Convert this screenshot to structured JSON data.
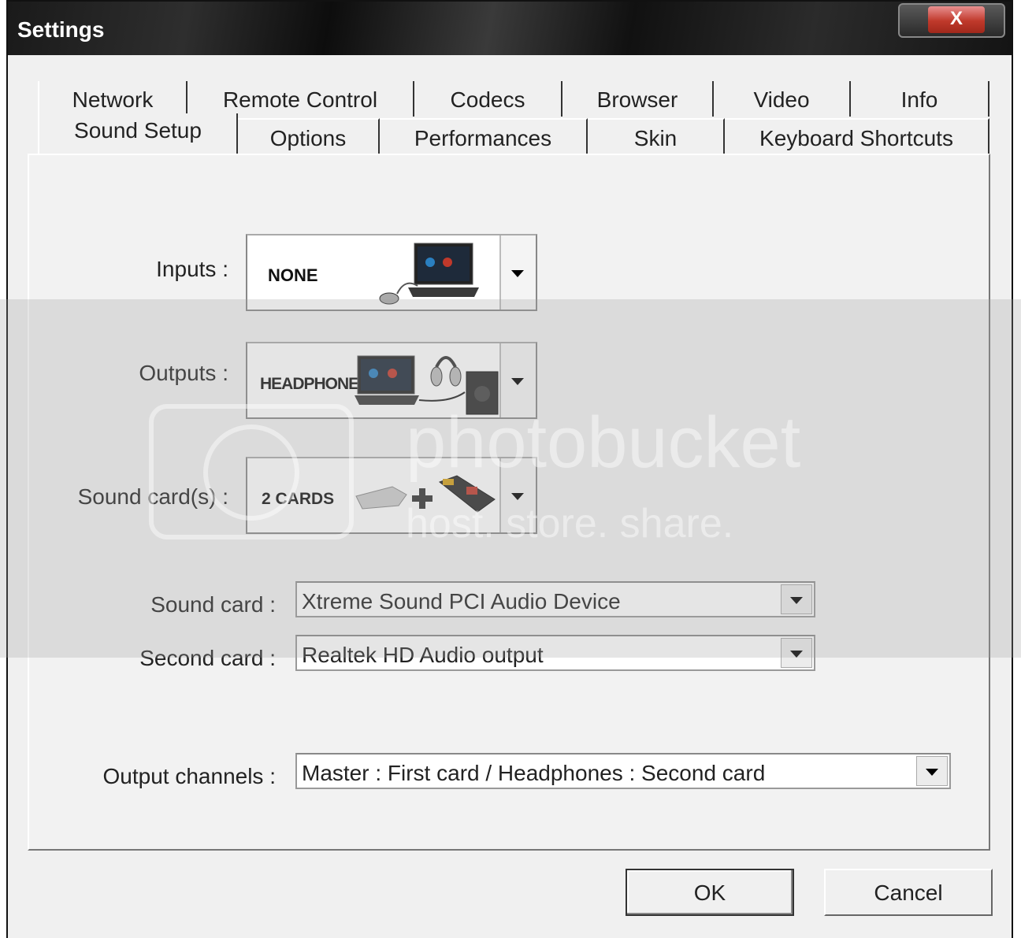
{
  "window": {
    "title": "Settings",
    "close_glyph": "X"
  },
  "tabs_row1": [
    {
      "label": "Network"
    },
    {
      "label": "Remote Control"
    },
    {
      "label": "Codecs"
    },
    {
      "label": "Browser"
    },
    {
      "label": "Video"
    },
    {
      "label": "Info"
    }
  ],
  "tabs_row2": [
    {
      "label": "Sound Setup",
      "active": true
    },
    {
      "label": "Options"
    },
    {
      "label": "Performances"
    },
    {
      "label": "Skin"
    },
    {
      "label": "Keyboard Shortcuts"
    }
  ],
  "sound_setup": {
    "inputs": {
      "label": "Inputs :",
      "value": "NONE",
      "icon": "laptop-mouse-icon"
    },
    "outputs": {
      "label": "Outputs :",
      "value": "HEADPHONES",
      "icon": "laptop-headphones-speaker-icon"
    },
    "sound_cards": {
      "label": "Sound card(s) :",
      "value": "2 CARDS",
      "icon": "soundcards-icon"
    },
    "sound_card": {
      "label": "Sound card :",
      "value": "Xtreme Sound PCI Audio Device"
    },
    "second_card": {
      "label": "Second card :",
      "value": "Realtek HD Audio output"
    },
    "output_channels": {
      "label": "Output channels :",
      "value": "Master : First card / Headphones : Second card"
    }
  },
  "buttons": {
    "ok": "OK",
    "cancel": "Cancel"
  },
  "watermark": {
    "brand": "photobucket",
    "tagline": "host. store. share."
  }
}
